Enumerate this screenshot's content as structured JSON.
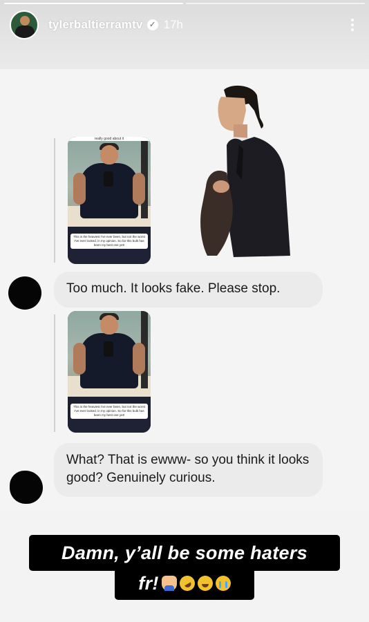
{
  "story": {
    "username": "tylerbaltierramtv",
    "verified_icon": "verified-badge-icon",
    "time_ago": "17h",
    "more_icon": "more-vertical-icon",
    "progress_segments": 2,
    "active_segment": 1
  },
  "chat": {
    "shared_image_caption_top": "really good about it",
    "shared_image_caption": "This is the heaviest I've ever been, but not the worst I've ever looked, in my opinion. So far this bulk has been my best one yet!",
    "messages": [
      {
        "text": "Too much. It looks fake. Please stop."
      },
      {
        "text": "What? That is ewww- so you think it looks good? Genuinely curious."
      }
    ]
  },
  "overlay": {
    "line1": "Damn, y’all be some haters",
    "line2": "fr!",
    "emojis": [
      "person-shrugging-emoji",
      "rolling-on-floor-laughing-emoji",
      "tears-of-joy-emoji",
      "loudly-crying-emoji"
    ]
  },
  "colors": {
    "bubble": "#ebebeb",
    "banner": "#000000",
    "banner_text": "#ffffff"
  }
}
